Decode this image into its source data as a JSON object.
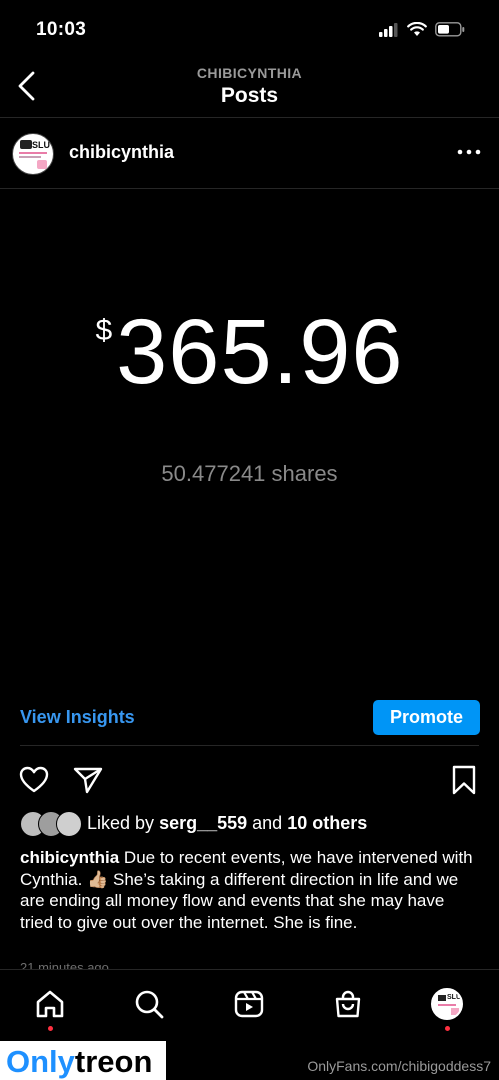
{
  "status": {
    "time": "10:03"
  },
  "header": {
    "subtitle": "CHIBICYNTHIA",
    "title": "Posts"
  },
  "post": {
    "author": "chibicynthia",
    "avatar_text": "SLUT",
    "currency_symbol": "$",
    "amount": "365.96",
    "shares": "50.477241 shares",
    "view_insights": "View Insights",
    "promote": "Promote",
    "likes": {
      "prefix": "Liked by",
      "user": "serg__559",
      "and": "and",
      "others": "10 others"
    },
    "caption_author": "chibicynthia",
    "caption": "Due to recent events, we have intervened with Cynthia. 👍🏼 She’s taking a different direction in life and we are ending all money flow and events that she may have tried to give out over the internet. She is fine.",
    "timestamp": "21 minutes ago"
  },
  "tabs": [
    "home-icon",
    "search-icon",
    "reels-icon",
    "shop-icon",
    "profile-avatar"
  ],
  "watermark": {
    "logo_left": "Only",
    "logo_right": "treon",
    "url": "OnlyFans.com/chibigoddess7"
  },
  "colors": {
    "accent": "#0095f6",
    "link": "#3897f0",
    "notification_dot": "#ff3040",
    "watermark_accent": "#1e90ff"
  }
}
